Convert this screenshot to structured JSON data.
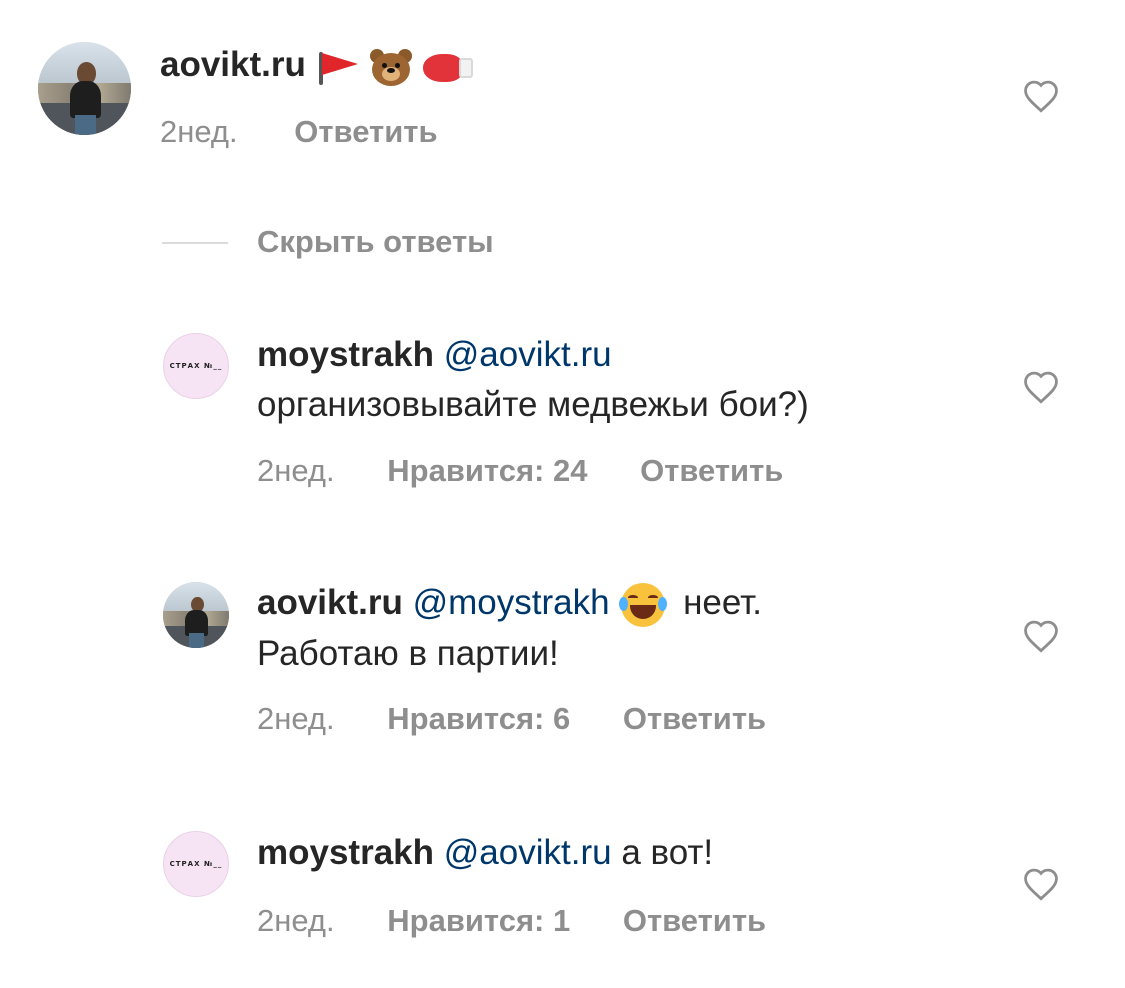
{
  "comments": [
    {
      "username": "aovikt.ru",
      "emojis": [
        "triangular-flag",
        "bear-face",
        "boxing-glove"
      ],
      "time": "2нед.",
      "reply": "Ответить"
    },
    {
      "username": "moystrakh",
      "mention": "@aovikt.ru",
      "text": "организовывайте медвежьи бои?)",
      "time": "2нед.",
      "likes": "Нравится: 24",
      "reply": "Ответить",
      "avatar_text": "СТРАХ №__"
    },
    {
      "username": "aovikt.ru",
      "mention": "@moystrakh",
      "emoji": "face-with-tears-of-joy",
      "text_line1": "неет.",
      "text_line2": "Работаю в партии!",
      "time": "2нед.",
      "likes": "Нравится: 6",
      "reply": "Ответить"
    },
    {
      "username": "moystrakh",
      "mention": "@aovikt.ru",
      "text": "а вот!",
      "time": "2нед.",
      "likes": "Нравится: 1",
      "reply": "Ответить",
      "avatar_text": "СТРАХ №__"
    }
  ],
  "hide_replies": "Скрыть ответы",
  "colors": {
    "username": "#262626",
    "mention": "#00376b",
    "meta": "#8e8e8e",
    "divider": "#dbdbdb",
    "brand_avatar_bg": "#f6e4f4"
  },
  "icons": {
    "like": "heart-outline-icon"
  }
}
